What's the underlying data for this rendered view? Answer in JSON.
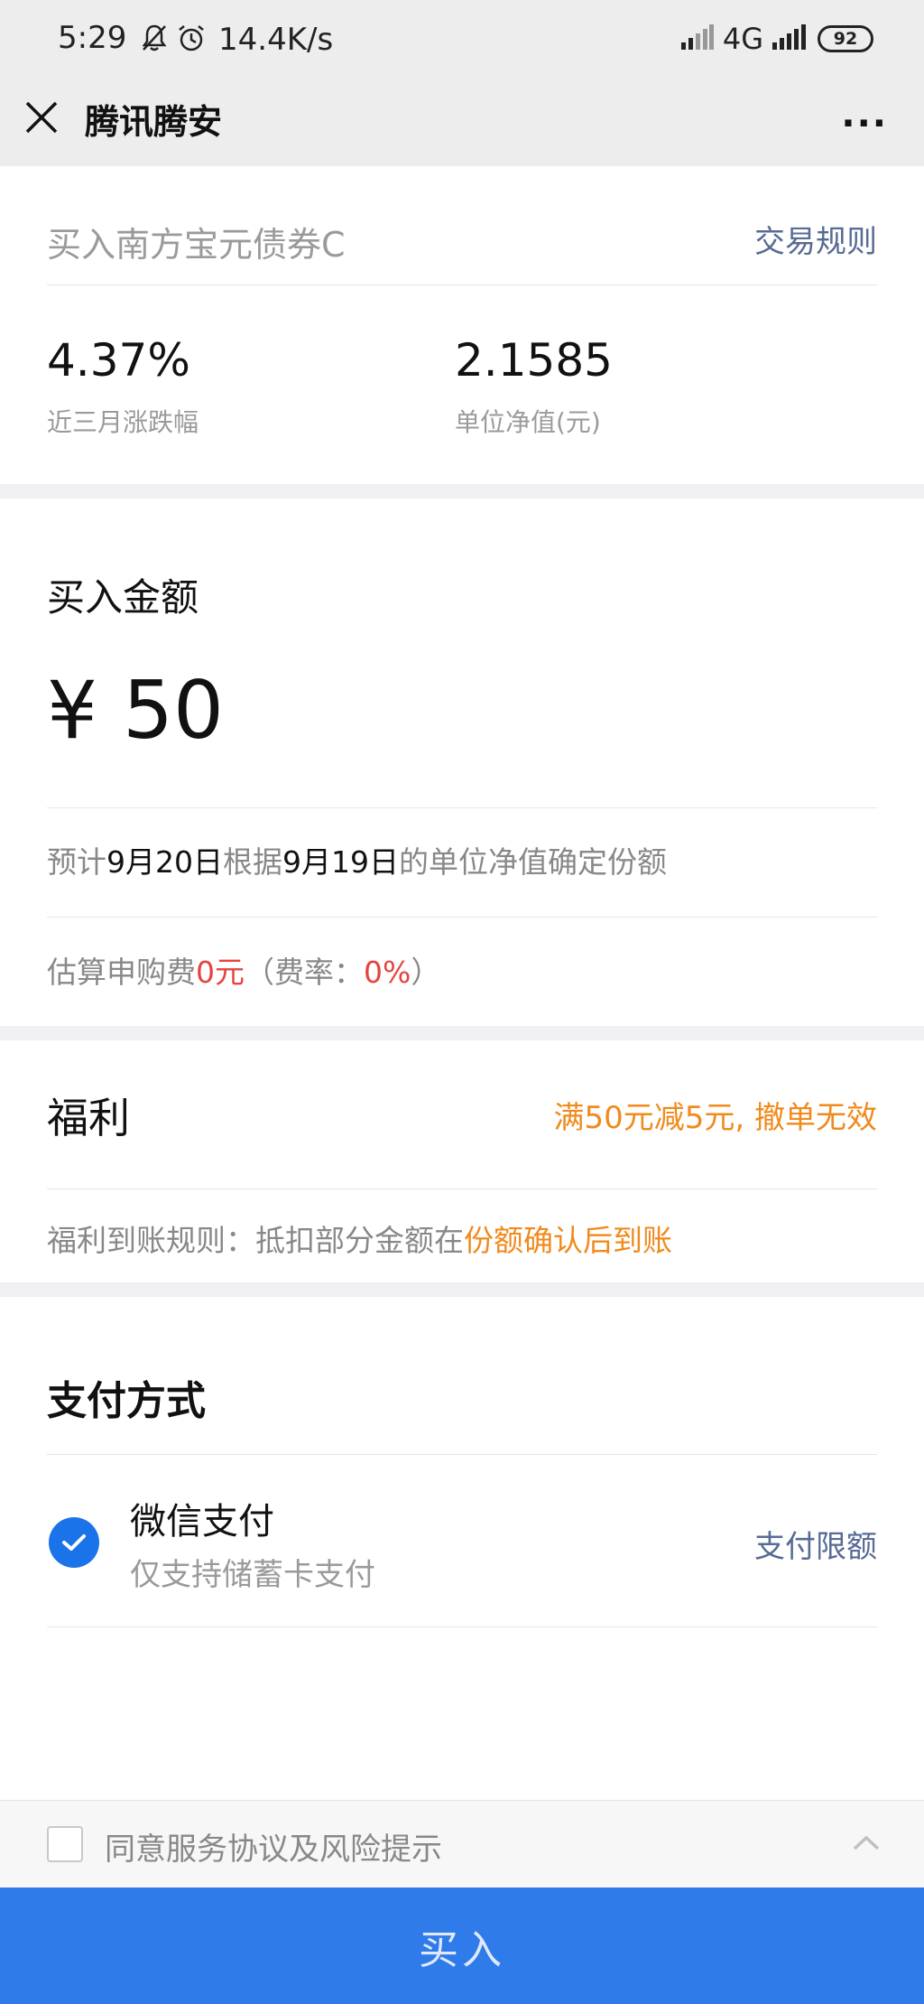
{
  "status_bar": {
    "time": "5:29",
    "speed": "14.4K/s",
    "network": "4G",
    "battery": "92"
  },
  "nav": {
    "title": "腾讯腾安",
    "more": "···"
  },
  "fund": {
    "name": "买入南方宝元债券C",
    "rules_link": "交易规则",
    "stats": [
      {
        "value": "4.37%",
        "label": "近三月涨跌幅"
      },
      {
        "value": "2.1585",
        "label": "单位净值(元)"
      }
    ]
  },
  "amount": {
    "title": "买入金额",
    "value": "¥ 50",
    "estimate": {
      "prefix": "预计",
      "date1": "9月20日",
      "mid": "根据",
      "date2": "9月19日",
      "suffix": "的单位净值确定份额"
    },
    "fee": {
      "prefix": "估算申购费",
      "amount": "0元",
      "rate_prefix": "（费率：",
      "rate": "0%",
      "rate_suffix": "）"
    }
  },
  "welfare": {
    "title": "福利",
    "offer": "满50元减5元, 撤单无效",
    "rule_prefix": "福利到账规则：抵扣部分金额在",
    "rule_highlight": "份额确认后到账"
  },
  "payment": {
    "title": "支付方式",
    "method": "微信支付",
    "method_sub": "仅支持储蓄卡支付",
    "limit_link": "支付限额"
  },
  "agreement": {
    "text": "同意服务协议及风险提示"
  },
  "buy_button": "买入",
  "colors": {
    "link_blue": "#576b95",
    "accent_orange": "#f08a1d",
    "accent_red": "#e64340",
    "button_blue": "#2f7bea",
    "check_blue": "#1a73e8"
  }
}
